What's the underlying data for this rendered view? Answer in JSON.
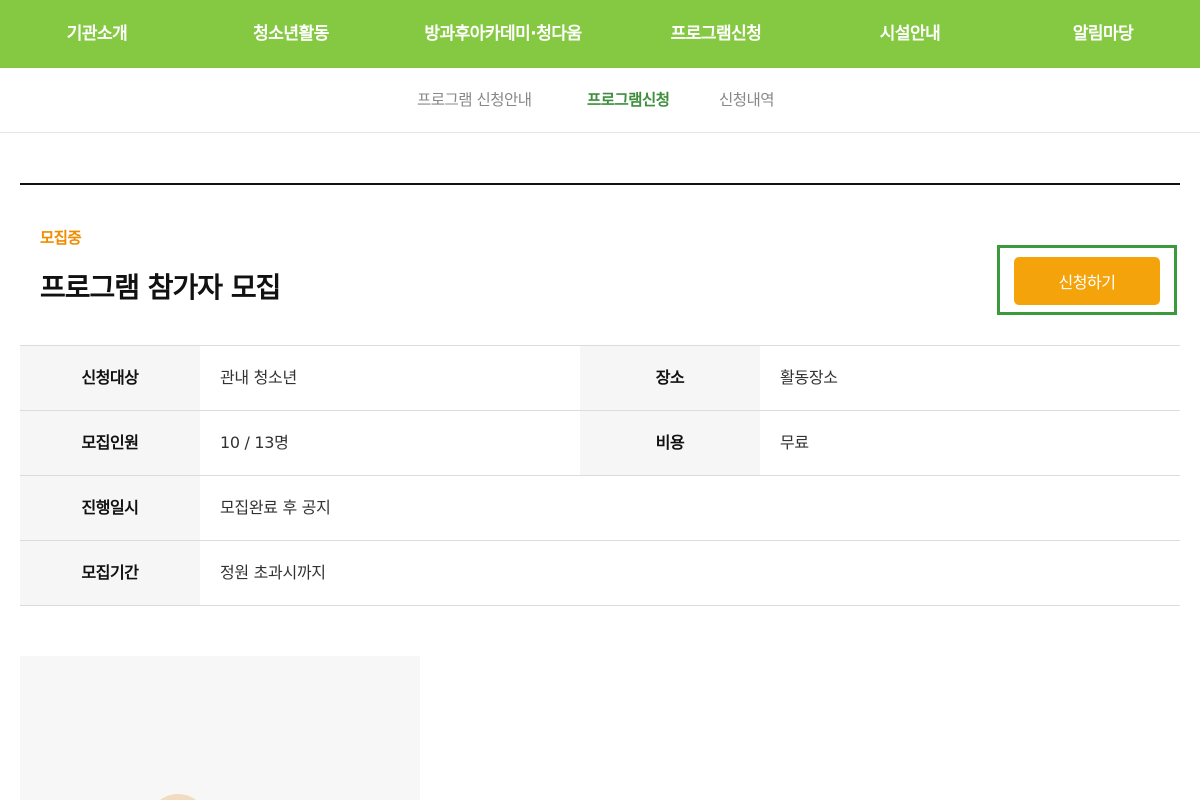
{
  "topnav": {
    "items": [
      {
        "label": "기관소개"
      },
      {
        "label": "청소년활동"
      },
      {
        "label": "방과후아카데미·청다움"
      },
      {
        "label": "프로그램신청"
      },
      {
        "label": "시설안내"
      },
      {
        "label": "알림마당"
      }
    ]
  },
  "subnav": {
    "items": [
      {
        "label": "프로그램 신청안내",
        "active": false
      },
      {
        "label": "프로그램신청",
        "active": true
      },
      {
        "label": "신청내역",
        "active": false
      }
    ]
  },
  "program": {
    "status": "모집중",
    "title": "프로그램 참가자 모집",
    "apply_label": "신청하기"
  },
  "info": {
    "rows": [
      {
        "label": "신청대상",
        "value": "관내 청소년",
        "label2": "장소",
        "value2": "활동장소"
      },
      {
        "label": "모집인원",
        "value": "10 / 13명",
        "label2": "비용",
        "value2": "무료"
      },
      {
        "label": "진행일시",
        "value": "모집완료 후 공지"
      },
      {
        "label": "모집기간",
        "value": "정원 초과시까지"
      }
    ]
  },
  "colors": {
    "nav_bg": "#85c841",
    "active_tab": "#3e8e3e",
    "status": "#f08c00",
    "apply_button": "#f5a30b",
    "highlight_frame": "#3b9a3b"
  }
}
